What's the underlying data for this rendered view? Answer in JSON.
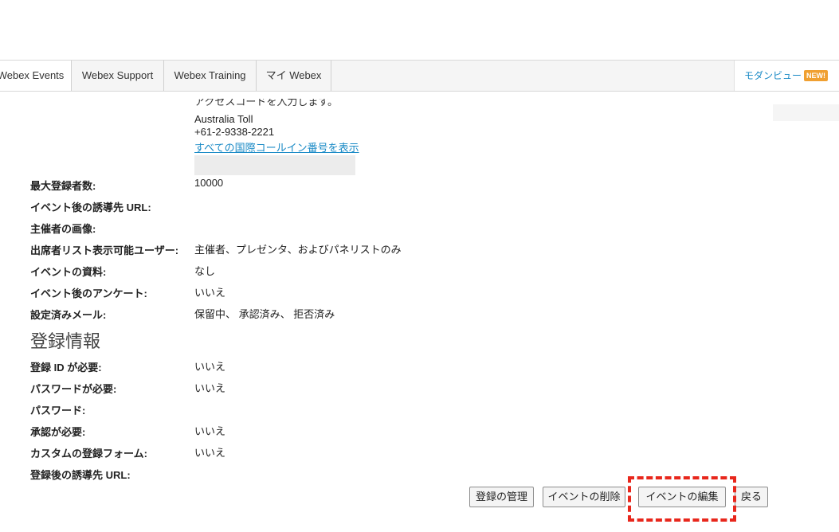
{
  "tabs": [
    {
      "label": "Webex Events"
    },
    {
      "label": "Webex Support"
    },
    {
      "label": "Webex Training"
    },
    {
      "label": "マイ Webex"
    }
  ],
  "modern_view": {
    "label": "モダンビュー",
    "badge": "NEW!"
  },
  "call_in": {
    "partial_text": "アクセスコードを入力します。",
    "number_label": "Australia Toll",
    "number": "+61-2-9338-2221",
    "all_numbers_link": "すべての国際コールイン番号を表示"
  },
  "event_info": [
    {
      "label": "最大登録者数:",
      "value": "10000"
    },
    {
      "label": "イベント後の誘導先 URL:",
      "value": ""
    },
    {
      "label": "主催者の画像:",
      "value": ""
    },
    {
      "label": "出席者リスト表示可能ユーザー:",
      "value": "主催者、プレゼンタ、およびパネリストのみ"
    },
    {
      "label": "イベントの資料:",
      "value": "なし"
    },
    {
      "label": "イベント後のアンケート:",
      "value": "いいえ"
    },
    {
      "label": "設定済みメール:",
      "value": "保留中、 承認済み、 拒否済み"
    }
  ],
  "registration": {
    "heading": "登録情報",
    "rows": [
      {
        "label": "登録 ID が必要:",
        "value": "いいえ"
      },
      {
        "label": "パスワードが必要:",
        "value": "いいえ"
      },
      {
        "label": "パスワード:",
        "value": ""
      },
      {
        "label": "承認が必要:",
        "value": "いいえ"
      },
      {
        "label": "カスタムの登録フォーム:",
        "value": "いいえ"
      },
      {
        "label": "登録後の誘導先 URL:",
        "value": ""
      }
    ]
  },
  "buttons": {
    "manage": "登録の管理",
    "delete": "イベントの削除",
    "edit": "イベントの編集",
    "back": "戻る"
  },
  "colors": {
    "link": "#1a8ac6",
    "badge": "#f0a031",
    "highlight": "#e8271c"
  }
}
